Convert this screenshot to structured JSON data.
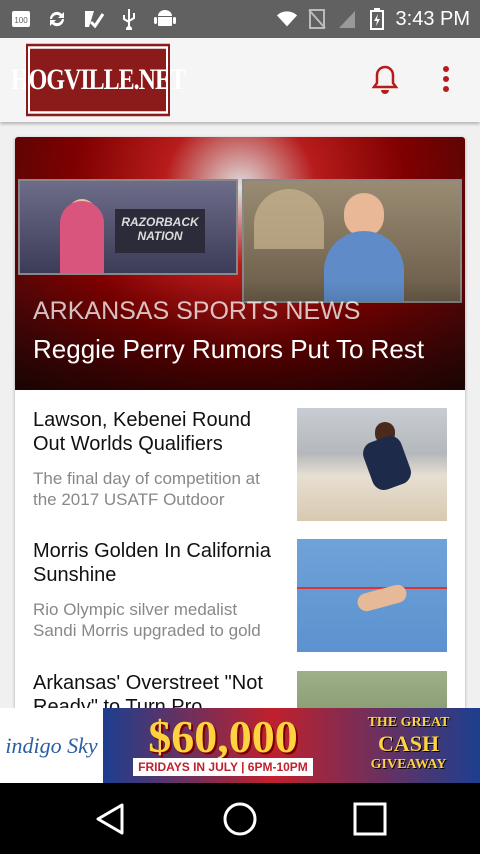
{
  "status_bar": {
    "time": "3:43 PM",
    "icons": [
      "notification-100-icon",
      "sync-icon",
      "check-icon",
      "usb-icon",
      "android-icon",
      "wifi-icon",
      "no-sim-icon",
      "signal-icon",
      "battery-charging-icon"
    ],
    "badge_100": "100"
  },
  "app_bar": {
    "logo_text": "HOGVILLE.NET",
    "notification_icon": "bell-icon",
    "menu_icon": "more-vert-icon",
    "accent_color": "#b71c1c"
  },
  "hero": {
    "kicker": "ARKANSAS SPORTS NEWS",
    "title": "Reggie Perry Rumors Put To Rest",
    "sign_text": "RAZORBACK NATION"
  },
  "articles": [
    {
      "title": "Lawson, Kebenei Round Out Worlds Qualifiers",
      "snippet": "The final day of competition at the 2017 USATF Outdoor"
    },
    {
      "title": "Morris Golden In California Sunshine",
      "snippet": "Rio Olympic silver medalist Sandi Morris upgraded to gold"
    },
    {
      "title": "Arkansas' Overstreet \"Not Ready\" to Turn Pro",
      "snippet": ""
    }
  ],
  "ad": {
    "brand": "indigo Sky",
    "amount": "$60,000",
    "sub": "FRIDAYS IN JULY | 6PM-10PM",
    "line1": "THE GREAT",
    "line2": "CASH",
    "line3": "GIVEAWAY"
  },
  "nav": {
    "back": "back-icon",
    "home": "home-icon",
    "recents": "recents-icon"
  }
}
